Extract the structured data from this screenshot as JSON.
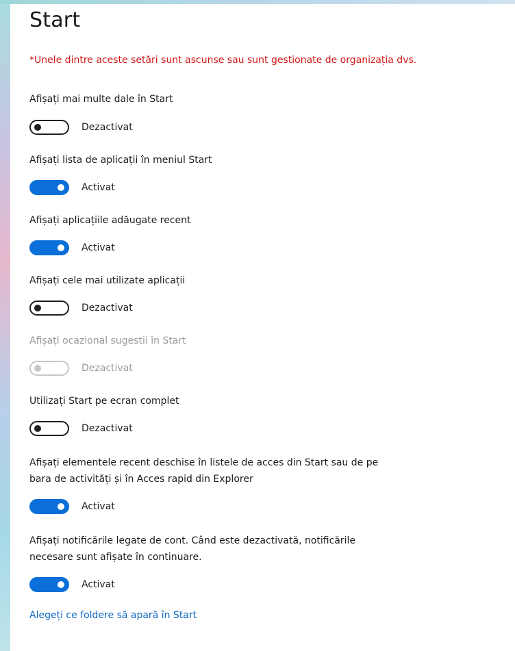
{
  "page": {
    "title": "Start",
    "org_note": "*Unele dintre aceste setări sunt ascunse sau sunt gestionate de organizația dvs."
  },
  "settings": [
    {
      "label": "Afișați mai multe dale în Start",
      "state": "Dezactivat",
      "on": false,
      "disabled": false
    },
    {
      "label": "Afișați lista de aplicații în meniul Start",
      "state": "Activat",
      "on": true,
      "disabled": false
    },
    {
      "label": "Afișați aplicațiile adăugate recent",
      "state": "Activat",
      "on": true,
      "disabled": false
    },
    {
      "label": "Afișați cele mai utilizate aplicații",
      "state": "Dezactivat",
      "on": false,
      "disabled": false
    },
    {
      "label": "Afișați ocazional sugestii în Start",
      "state": "Dezactivat",
      "on": false,
      "disabled": true
    },
    {
      "label": "Utilizați Start pe ecran complet",
      "state": "Dezactivat",
      "on": false,
      "disabled": false
    },
    {
      "label_line1": "Afișați elementele recent deschise în listele de acces din Start sau de pe",
      "label_line2": "bara de activități și în Acces rapid din Explorer",
      "state": "Activat",
      "on": true,
      "disabled": false
    },
    {
      "label_line1": "Afișați notificările legate de cont. Când este dezactivată, notificările",
      "label_line2": "necesare sunt afișate în continuare.",
      "state": "Activat",
      "on": true,
      "disabled": false
    }
  ],
  "link": {
    "label": "Alegeți ce foldere să apară în Start"
  },
  "colors": {
    "accent": "#0a6fd8",
    "warning": "#d01616",
    "link": "#0a66c2"
  }
}
